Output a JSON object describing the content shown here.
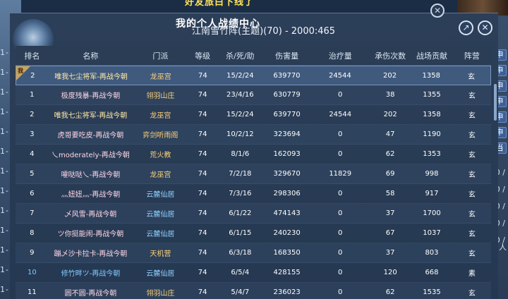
{
  "background": {
    "notice_text": "好友旅白下线了",
    "left_marks": [
      "1-",
      "1-",
      "1-",
      "1-",
      "1-",
      "1-",
      "1-",
      "1-",
      "1-",
      "1-",
      "1-",
      "1-",
      "1-"
    ],
    "right_items": [
      "申",
      "申",
      "申",
      "申",
      "申",
      "申",
      "当"
    ],
    "right_nums": [
      "0 /",
      "0 /",
      "0 /",
      "0 /",
      "0 /"
    ],
    "right_bottom": "人"
  },
  "panel": {
    "title": "我的个人战绩中心",
    "battle_header": "江南雪竹阵(主题)(70) - 2000:465",
    "share_icon": "share-icon",
    "close_icon": "close-icon"
  },
  "table": {
    "headers": [
      "排名",
      "名称",
      "门派",
      "等级",
      "杀/死/助",
      "伤害量",
      "治疗量",
      "承伤次数",
      "战场贡献",
      "阵营"
    ],
    "pinned_badge": "我",
    "rows": [
      {
        "rank": "2",
        "name": "唯我七尘将军-再战今朝",
        "sect": "龙巫宫",
        "level": "74",
        "kda": "15/2/24",
        "damage": "639770",
        "heal": "24544",
        "hits": "202",
        "contrib": "1358",
        "camp": "玄"
      },
      {
        "rank": "1",
        "name": "极度残暴-再战今朝",
        "sect": "翎羽山庄",
        "level": "74",
        "kda": "23/4/16",
        "damage": "630779",
        "heal": "0",
        "hits": "38",
        "contrib": "1355",
        "camp": "玄"
      },
      {
        "rank": "2",
        "name": "唯我七尘将军-再战今朝",
        "sect": "龙巫宫",
        "level": "74",
        "kda": "15/2/24",
        "damage": "639770",
        "heal": "24544",
        "hits": "202",
        "contrib": "1358",
        "camp": "玄"
      },
      {
        "rank": "3",
        "name": "虎哥要吃皮-再战今朝",
        "sect": "弈剑听雨阁",
        "level": "74",
        "kda": "10/2/12",
        "damage": "323694",
        "heal": "0",
        "hits": "47",
        "contrib": "1190",
        "camp": "玄"
      },
      {
        "rank": "4",
        "name": "乀moderately-再战今朝",
        "sect": "荒火教",
        "level": "74",
        "kda": "8/1/6",
        "damage": "162093",
        "heal": "0",
        "hits": "62",
        "contrib": "1353",
        "camp": "玄"
      },
      {
        "rank": "5",
        "name": "嚯哒哒乀-再战今朝",
        "sect": "龙巫宫",
        "level": "74",
        "kda": "7/2/18",
        "damage": "329670",
        "heal": "11829",
        "hits": "69",
        "contrib": "998",
        "camp": "玄"
      },
      {
        "rank": "6",
        "name": "灬妞妞灬-再战今朝",
        "sect": "云麓仙居",
        "level": "74",
        "kda": "7/3/16",
        "damage": "298306",
        "heal": "0",
        "hits": "58",
        "contrib": "917",
        "camp": "玄"
      },
      {
        "rank": "7",
        "name": "乄风雪-再战今朝",
        "sect": "云麓仙居",
        "level": "74",
        "kda": "6/1/22",
        "damage": "474143",
        "heal": "0",
        "hits": "37",
        "contrib": "1700",
        "camp": "玄"
      },
      {
        "rank": "8",
        "name": "ツ你挺能闹-再战今朝",
        "sect": "云麓仙居",
        "level": "74",
        "kda": "6/1/15",
        "damage": "240230",
        "heal": "0",
        "hits": "67",
        "contrib": "1037",
        "camp": "玄"
      },
      {
        "rank": "9",
        "name": "蹦乄沙卡拉卡-再战今朝",
        "sect": "天机营",
        "level": "74",
        "kda": "6/3/18",
        "damage": "168350",
        "heal": "0",
        "hits": "37",
        "contrib": "803",
        "camp": "玄"
      },
      {
        "rank": "10",
        "name": "修竹畔ツ-再战今朝",
        "sect": "云麓仙居",
        "level": "74",
        "kda": "6/5/4",
        "damage": "428155",
        "heal": "0",
        "hits": "120",
        "contrib": "668",
        "camp": "素"
      },
      {
        "rank": "11",
        "name": "圆不圆-再战今朝",
        "sect": "翎羽山庄",
        "level": "74",
        "kda": "5/4/7",
        "damage": "236023",
        "heal": "0",
        "hits": "62",
        "contrib": "1535",
        "camp": "玄"
      }
    ]
  },
  "colors": {
    "panel_bg": "#2c3f58",
    "highlight_row": "#405a7e",
    "name_text": "#ffd6e6",
    "sect_text": "#ffd37a",
    "accent_blue": "#7fc9ff"
  }
}
